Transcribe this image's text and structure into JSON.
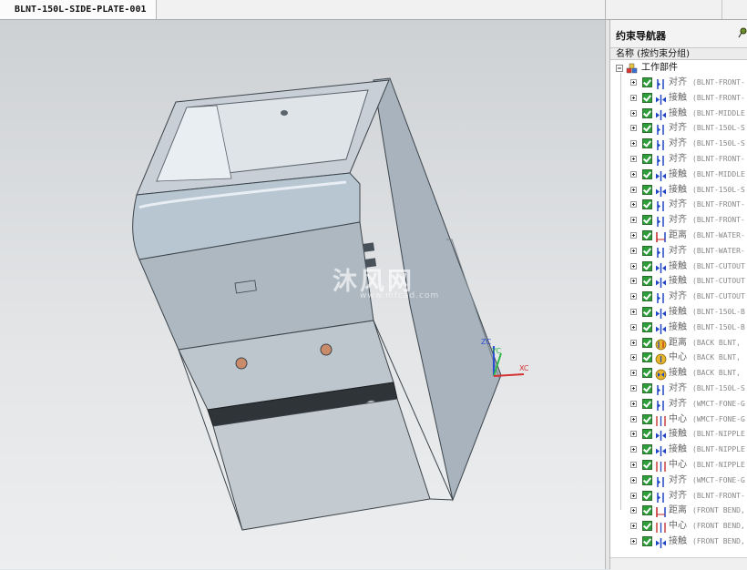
{
  "window": {
    "tab_title": "BLNT-150L-SIDE-PLATE-001"
  },
  "watermark": {
    "text": "沐风网",
    "sub": "www.mfcad.com"
  },
  "triad": {
    "zc": "ZC",
    "yc": "YC",
    "xc": "XC"
  },
  "navigator": {
    "title": "约束导航器",
    "column_header": "名称 (按约束分组)",
    "root_label": "工作部件",
    "rows": [
      {
        "type": "对齐",
        "name": "(BLNT-FRONT-",
        "icon": "align-icon"
      },
      {
        "type": "接触",
        "name": "(BLNT-FRONT-",
        "icon": "touch-icon"
      },
      {
        "type": "接触",
        "name": "(BLNT-MIDDLE",
        "icon": "touch-icon"
      },
      {
        "type": "对齐",
        "name": "(BLNT-150L-S",
        "icon": "align-icon"
      },
      {
        "type": "对齐",
        "name": "(BLNT-150L-S",
        "icon": "align-icon"
      },
      {
        "type": "对齐",
        "name": "(BLNT-FRONT-",
        "icon": "align-icon"
      },
      {
        "type": "接触",
        "name": "(BLNT-MIDDLE",
        "icon": "touch-icon"
      },
      {
        "type": "接触",
        "name": "(BLNT-150L-S",
        "icon": "touch-icon"
      },
      {
        "type": "对齐",
        "name": "(BLNT-FRONT-",
        "icon": "align-icon"
      },
      {
        "type": "对齐",
        "name": "(BLNT-FRONT-",
        "icon": "align-icon"
      },
      {
        "type": "距离",
        "name": "(BLNT-WATER-",
        "icon": "distance-icon"
      },
      {
        "type": "对齐",
        "name": "(BLNT-WATER-",
        "icon": "align-icon"
      },
      {
        "type": "接触",
        "name": "(BLNT-CUTOUT",
        "icon": "touch-icon"
      },
      {
        "type": "接触",
        "name": "(BLNT-CUTOUT",
        "icon": "touch-icon"
      },
      {
        "type": "对齐",
        "name": "(BLNT-CUTOUT",
        "icon": "align-icon"
      },
      {
        "type": "接触",
        "name": "(BLNT-150L-B",
        "icon": "touch-icon"
      },
      {
        "type": "接触",
        "name": "(BLNT-150L-B",
        "icon": "touch-icon"
      },
      {
        "type": "距离",
        "name": "(BACK BLNT, ",
        "icon": "warn-distance-icon"
      },
      {
        "type": "中心",
        "name": "(BACK BLNT, ",
        "icon": "warn-center-icon"
      },
      {
        "type": "接触",
        "name": "(BACK BLNT, ",
        "icon": "warn-touch-icon"
      },
      {
        "type": "对齐",
        "name": "(BLNT-150L-S",
        "icon": "align-icon"
      },
      {
        "type": "对齐",
        "name": "(WMCT-FONE-G",
        "icon": "align-icon"
      },
      {
        "type": "中心",
        "name": "(WMCT-FONE-G",
        "icon": "center-icon"
      },
      {
        "type": "接触",
        "name": "(BLNT-NIPPLE",
        "icon": "touch-icon"
      },
      {
        "type": "接触",
        "name": "(BLNT-NIPPLE",
        "icon": "touch-icon"
      },
      {
        "type": "中心",
        "name": "(BLNT-NIPPLE",
        "icon": "center-icon"
      },
      {
        "type": "对齐",
        "name": "(WMCT-FONE-G",
        "icon": "align-icon"
      },
      {
        "type": "对齐",
        "name": "(BLNT-FRONT-",
        "icon": "align-icon"
      },
      {
        "type": "距离",
        "name": "(FRONT BEND,",
        "icon": "distance-icon"
      },
      {
        "type": "中心",
        "name": "(FRONT BEND,",
        "icon": "center-icon"
      },
      {
        "type": "接触",
        "name": "(FRONT BEND,",
        "icon": "touch-icon"
      }
    ]
  }
}
